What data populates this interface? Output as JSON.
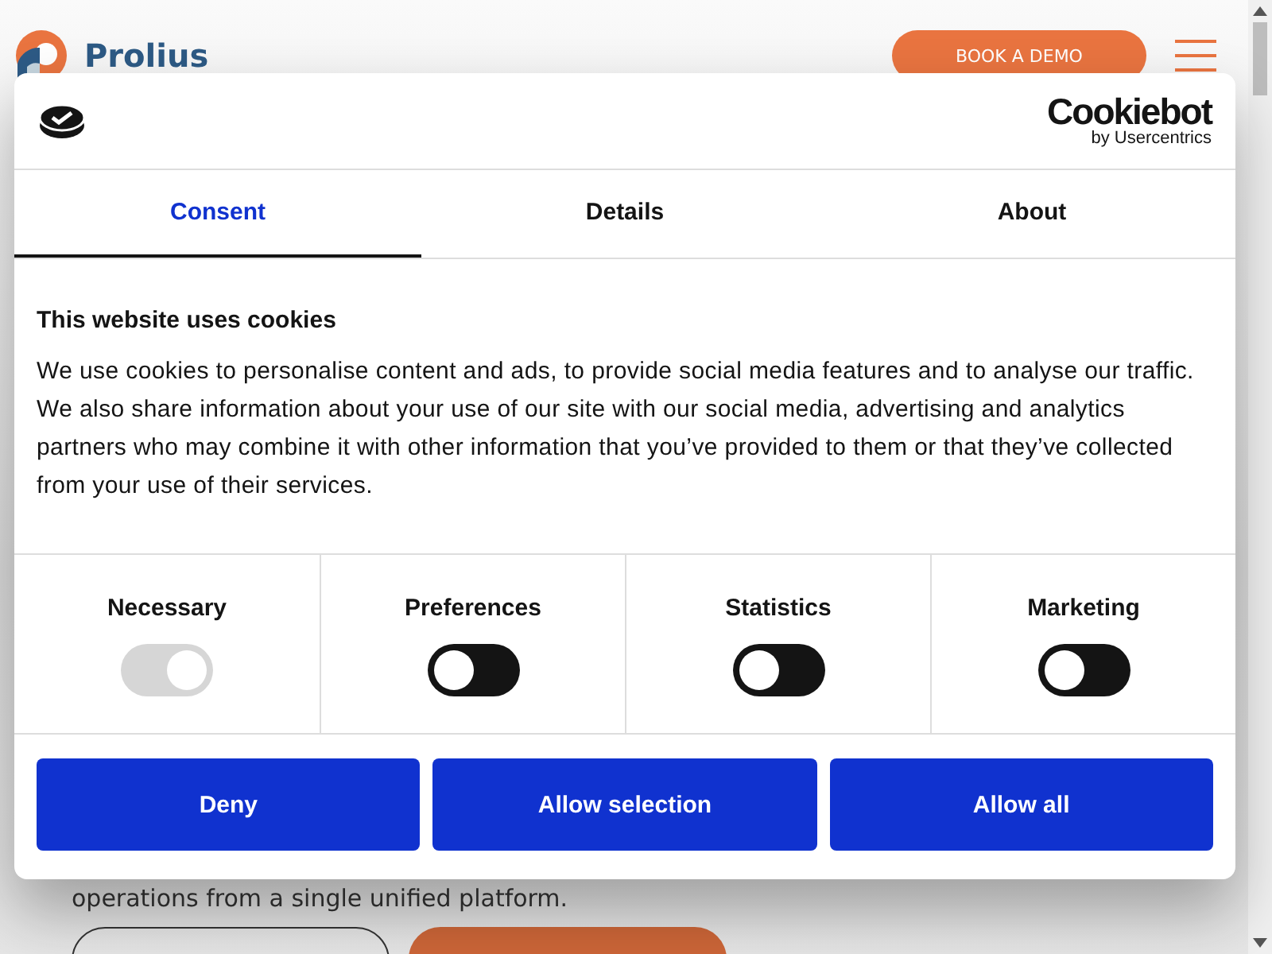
{
  "header": {
    "brand": "Prolius",
    "cta": "BOOK A DEMO"
  },
  "page": {
    "text": "operations from a single unified platform."
  },
  "dialog": {
    "brand": "Cookiebot",
    "brand_sub": "by Usercentrics",
    "tabs": [
      {
        "label": "Consent",
        "selected": true
      },
      {
        "label": "Details",
        "selected": false
      },
      {
        "label": "About",
        "selected": false
      }
    ],
    "heading": "This website uses cookies",
    "body": "We use cookies to personalise content and ads, to provide social media features and to analyse our traffic. We also share information about your use of our site with our social media, advertising and analytics partners who may combine it with other information that you’ve provided to them or that they’ve collected from your use of their services.",
    "categories": [
      {
        "label": "Necessary",
        "checked": true,
        "disabled": true
      },
      {
        "label": "Preferences",
        "checked": false,
        "disabled": false
      },
      {
        "label": "Statistics",
        "checked": false,
        "disabled": false
      },
      {
        "label": "Marketing",
        "checked": false,
        "disabled": false
      }
    ],
    "buttons": [
      "Deny",
      "Allow selection",
      "Allow all"
    ]
  }
}
